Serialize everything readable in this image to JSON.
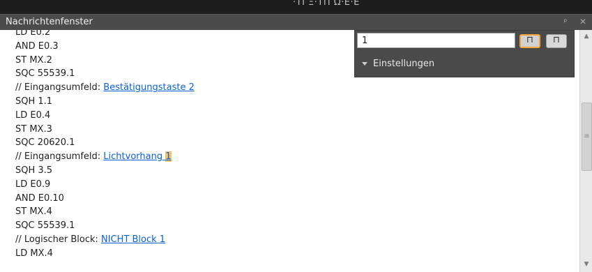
{
  "top_strip": {
    "partial_text": "·ΤΙ Ξ·ΤΠ Ω·Ε·Ε"
  },
  "window": {
    "title": "Nachrichtenfenster",
    "pin_glyph": "ᵖ",
    "close_glyph": "✕"
  },
  "log_lines": [
    {
      "text": "LD E0.2"
    },
    {
      "text": "AND E0.3"
    },
    {
      "text": "ST MX.2"
    },
    {
      "text": "SQC 55539.1"
    },
    {
      "text": "// Eingangsumfeld: ",
      "link": "Bestätigungstaste 2"
    },
    {
      "text": "SQH 1.1"
    },
    {
      "text": "LD E0.4"
    },
    {
      "text": "ST MX.3"
    },
    {
      "text": "SQC 20620.1"
    },
    {
      "text": "// Eingangsumfeld: ",
      "link": "Lichtvorhang ",
      "highlight": "1"
    },
    {
      "text": "SQH 3.5"
    },
    {
      "text": "LD E0.9"
    },
    {
      "text": "AND E0.10"
    },
    {
      "text": "ST MX.4"
    },
    {
      "text": "SQC 55539.1"
    },
    {
      "text": "// Logischer Block: ",
      "link": "NICHT Block 1"
    },
    {
      "text": "LD MX.4"
    }
  ],
  "find_panel": {
    "search_value": "1",
    "option_1_glyph": "⊓",
    "option_2_glyph": "⊓",
    "settings_label": "Einstellungen"
  },
  "scrollbar": {
    "up_arrow": "▲",
    "down_arrow": "▼",
    "grip": "≡"
  },
  "colors": {
    "link": "#0b60d6",
    "highlight": "#f7c36b",
    "active_option_border": "#f0a43a",
    "titlebar": "#4b4b4b",
    "panel": "#4a4a4a"
  }
}
